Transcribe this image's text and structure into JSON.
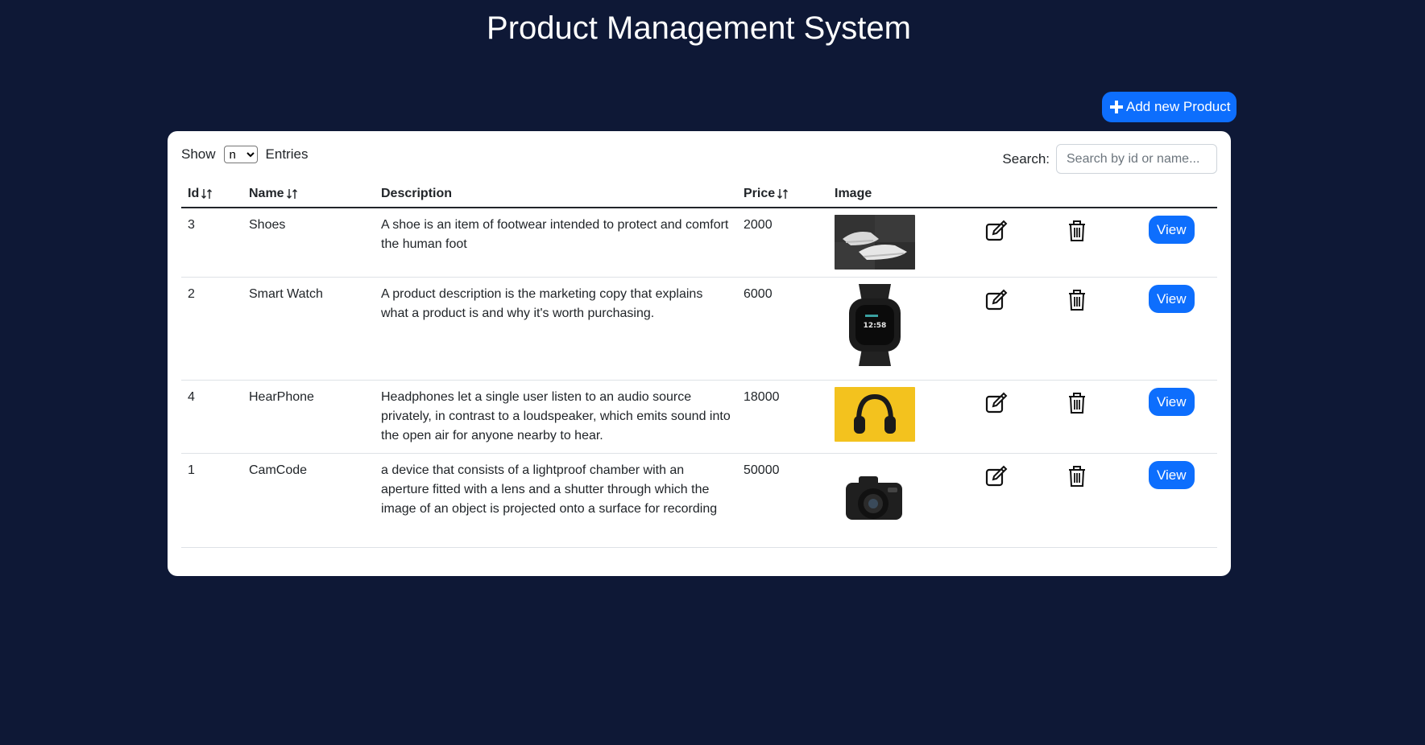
{
  "header": {
    "title": "Product Management System"
  },
  "toolbar": {
    "add_label": "Add new Product"
  },
  "controls": {
    "show_label": "Show",
    "entries_label": "Entries",
    "show_value": "n",
    "search_label": "Search:",
    "search_placeholder": "Search by id or name..."
  },
  "table": {
    "columns": [
      "Id",
      "Name",
      "Description",
      "Price",
      "Image"
    ],
    "rows": [
      {
        "id": "3",
        "name": "Shoes",
        "description": "A shoe is an item of footwear intended to protect and comfort the human foot",
        "price": "2000",
        "image": "shoes"
      },
      {
        "id": "2",
        "name": "Smart Watch",
        "description": "A product description is the marketing copy that explains what a product is and why it's worth purchasing.",
        "price": "6000",
        "image": "smart-watch"
      },
      {
        "id": "4",
        "name": "HearPhone",
        "description": "Headphones let a single user listen to an audio source privately, in contrast to a loudspeaker, which emits sound into the open air for anyone nearby to hear.",
        "price": "18000",
        "image": "headphones"
      },
      {
        "id": "1",
        "name": "CamCode",
        "description": "a device that consists of a lightproof chamber with an aperture fitted with a lens and a shutter through which the image of an object is projected onto a surface for recording",
        "price": "50000",
        "image": "camera"
      }
    ],
    "view_label": "View"
  },
  "colors": {
    "background": "#0e1836",
    "primary": "#0d6efd",
    "card": "#ffffff"
  },
  "icons": {
    "add": "plus-icon",
    "sort": "sort-icon",
    "edit": "edit-icon",
    "delete": "trash-icon"
  }
}
